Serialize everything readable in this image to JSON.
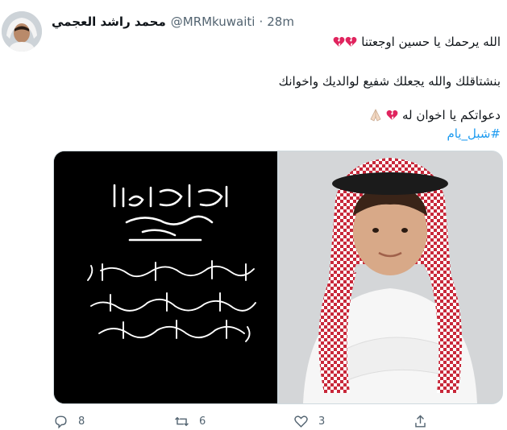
{
  "tweet": {
    "author_name": "محمد راشد العجمي",
    "author_handle": "@MRMkuwaiti",
    "separator": "·",
    "time": "28m",
    "lines": {
      "line1": "الله يرحمك يا حسين اوجعتنا",
      "line2": "بنشتاقلك والله يجعلك شفيع لوالديك واخوانك",
      "line3": "دعواتكم يا اخوان له",
      "hashtag": "#شبل_يام"
    },
    "images": {
      "left": {
        "verse_title": "إنا لله وإنا إليه راجعون",
        "verse_body": "{ يا أيتها النفس المطمئنة ارجعي إلى ربك راضية مرضية فادخلي في عبادي وادخلي جنتي }"
      },
      "right": {
        "description_icon": "child-portrait-icon"
      }
    },
    "actions": {
      "reply_count": "8",
      "retweet_count": "6",
      "like_count": "3"
    },
    "colors": {
      "link": "#1d9bf0",
      "muted": "#536471",
      "heart": "#e0245e"
    }
  }
}
